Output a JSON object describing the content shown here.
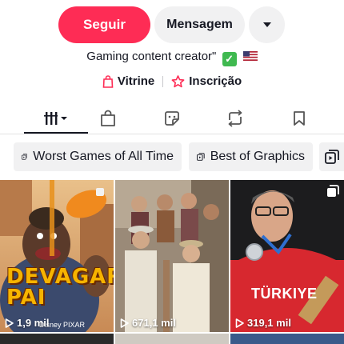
{
  "actions": {
    "follow_label": "Seguir",
    "message_label": "Mensagem",
    "more_icon": "caret-down-icon"
  },
  "bio": {
    "text": "Gaming content creator\"",
    "check_icon": "check-icon",
    "flag_icon": "us-flag-icon"
  },
  "links": {
    "showcase_label": "Vitrine",
    "subscription_label": "Inscrição"
  },
  "tabs": [
    {
      "name": "videos",
      "icon": "grid-icon"
    },
    {
      "name": "shop",
      "icon": "bag-icon"
    },
    {
      "name": "stickers",
      "icon": "sticker-icon"
    },
    {
      "name": "reposts",
      "icon": "repost-icon"
    },
    {
      "name": "saved",
      "icon": "bookmark-icon"
    }
  ],
  "playlists": [
    {
      "label": "Worst Games of All Time"
    },
    {
      "label": "Best of Graphics"
    }
  ],
  "videos": [
    {
      "views": "1,9 mil",
      "overlay_title": "DEVAGAR PAI",
      "watermark": "Disney PIXAR"
    },
    {
      "views": "671,1 mil"
    },
    {
      "views": "319,1 mil",
      "jersey_text": "TÜRKIYE"
    }
  ],
  "colors": {
    "accent": "#fe2c55",
    "button_gray": "#f1f1f2",
    "text": "#161823"
  }
}
